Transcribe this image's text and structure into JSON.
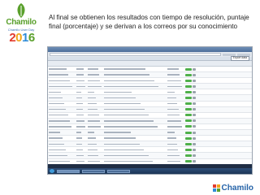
{
  "heading": "Al final se obtienen los resultados con tiempo de resolución, puntaje final (porcentaje) y se derivan a los correos por su conocimiento",
  "logo": {
    "brand": "Chamilo",
    "subtitle": "Chamilo User Day",
    "year": [
      "2",
      "0",
      "1",
      "6"
    ]
  },
  "footer": {
    "brand": "Chamilo"
  },
  "screenshot": {
    "toolbar_button": "Export data",
    "rows": 20
  },
  "colors": {
    "accent_green": "#5aa02c",
    "brand_blue": "#2563a8",
    "pill_green": "#4fb04a"
  }
}
